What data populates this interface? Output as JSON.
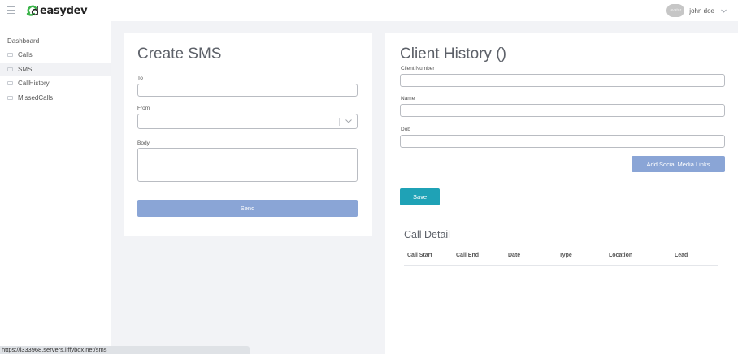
{
  "header": {
    "logo_text": "easydev",
    "user_name": "john doe",
    "avatar_text": "avatar"
  },
  "sidebar": {
    "items": [
      {
        "label": "Dashboard",
        "icon": "none"
      },
      {
        "label": "Calls",
        "icon": "list-icon"
      },
      {
        "label": "SMS",
        "icon": "list-icon",
        "active": true
      },
      {
        "label": "CallHistory",
        "icon": "list-icon"
      },
      {
        "label": "MissedCalls",
        "icon": "list-icon"
      }
    ]
  },
  "sms_form": {
    "title": "Create SMS",
    "to_label": "To",
    "to_value": "",
    "from_label": "From",
    "from_value": "",
    "body_label": "Body",
    "body_value": "",
    "send_label": "Send"
  },
  "client": {
    "title": "Client History ()",
    "number_label": "Client Number",
    "number_value": "",
    "name_label": "Name",
    "name_value": "",
    "dob_label": "Dob",
    "dob_value": "",
    "social_button_label": "Add Social Media Links",
    "save_button_label": "Save"
  },
  "call_detail": {
    "title": "Call Detail",
    "columns": [
      "Call Start",
      "Call End",
      "Date",
      "Type",
      "Location",
      "Lead"
    ]
  },
  "status_bar": {
    "url": "https://i333968.servers.iiffybox.net/sms"
  },
  "colors": {
    "accent_blue": "#8aa5d6",
    "save_teal": "#1fa2b6",
    "logo_green": "#3bb44a"
  }
}
